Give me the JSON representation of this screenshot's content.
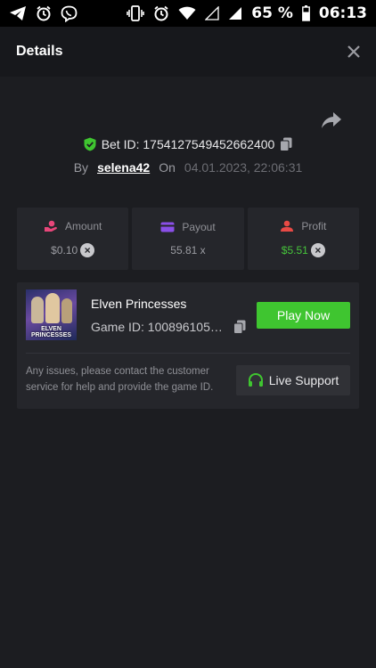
{
  "status_bar": {
    "battery": "65 %",
    "time": "06:13"
  },
  "header": {
    "title": "Details"
  },
  "bet": {
    "id_text": "Bet ID: 1754127549452662400",
    "by_label": "By",
    "username": "selena42",
    "on_label": "On",
    "date": "04.01.2023, 22:06:31"
  },
  "stats": {
    "amount": {
      "label": "Amount",
      "value": "$0.10"
    },
    "payout": {
      "label": "Payout",
      "value": "55.81 x"
    },
    "profit": {
      "label": "Profit",
      "value": "$5.51"
    }
  },
  "game": {
    "thumbnail_label_line1": "ELVEN",
    "thumbnail_label_line2": "PRINCESSES",
    "name": "Elven Princesses",
    "id_text": "Game ID: 1008961057...",
    "play_label": "Play Now",
    "issues_text": "Any issues, please contact the customer service for help and provide the game ID.",
    "support_label": "Live Support"
  },
  "colors": {
    "accent_green": "#3fc530",
    "background": "#1c1d21",
    "panel": "#25262b"
  }
}
